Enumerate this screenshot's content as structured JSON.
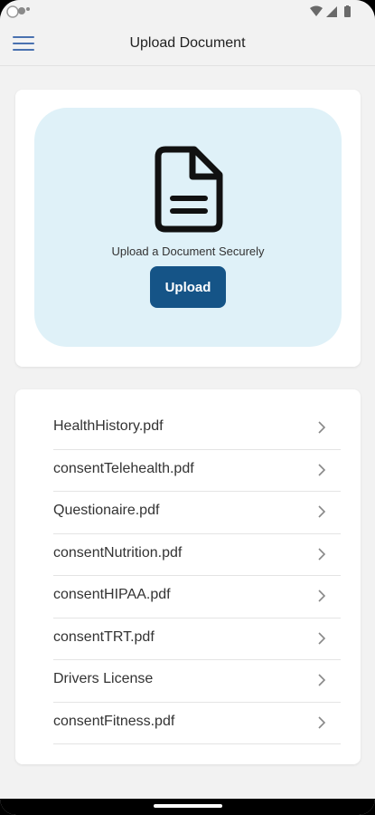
{
  "app_bar": {
    "title": "Upload Document",
    "menu_icon": "hamburger-menu-icon"
  },
  "upload_card": {
    "icon": "document-icon",
    "caption": "Upload a Document Securely",
    "button_label": "Upload",
    "zone_color": "#dff1f8",
    "button_color": "#155487"
  },
  "documents": [
    {
      "name": "HealthHistory.pdf"
    },
    {
      "name": "consentTelehealth.pdf"
    },
    {
      "name": "Questionaire.pdf"
    },
    {
      "name": "consentNutrition.pdf"
    },
    {
      "name": "consentHIPAA.pdf"
    },
    {
      "name": "consentTRT.pdf"
    },
    {
      "name": "Drivers License"
    },
    {
      "name": "consentFitness.pdf"
    }
  ],
  "status_bar": {
    "icons": [
      "app-icon",
      "notification-icon",
      "wifi-icon",
      "signal-icon",
      "battery-icon"
    ]
  }
}
